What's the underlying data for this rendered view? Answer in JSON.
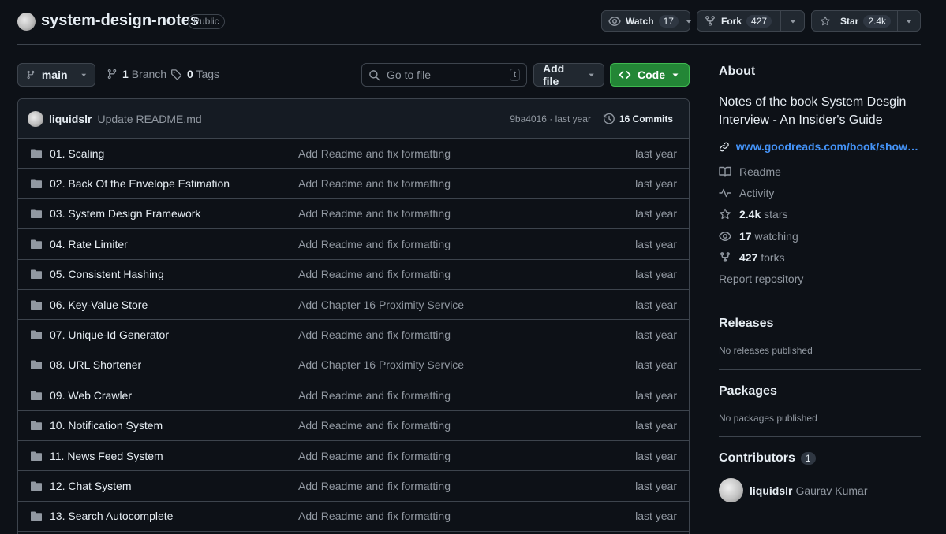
{
  "repo": {
    "name": "system-design-notes",
    "visibility": "Public"
  },
  "header_actions": {
    "watch": {
      "label": "Watch",
      "count": "17"
    },
    "fork": {
      "label": "Fork",
      "count": "427"
    },
    "star": {
      "label": "Star",
      "count": "2.4k"
    }
  },
  "toolbar": {
    "branch": "main",
    "branch_count": "1",
    "branch_label": "Branch",
    "tag_count": "0",
    "tag_label": "Tags",
    "search_placeholder": "Go to file",
    "search_shortcut": "t",
    "add_file": "Add file",
    "code": "Code"
  },
  "latest_commit": {
    "user": "liquidslr",
    "message": "Update README.md",
    "hash_time": "9ba4016 · last year",
    "commits": "16 Commits"
  },
  "files": [
    {
      "name": "01. Scaling",
      "message": "Add Readme and fix formatting",
      "date": "last year"
    },
    {
      "name": "02. Back Of the Envelope Estimation",
      "message": "Add Readme and fix formatting",
      "date": "last year"
    },
    {
      "name": "03. System Design Framework",
      "message": "Add Readme and fix formatting",
      "date": "last year"
    },
    {
      "name": "04. Rate Limiter",
      "message": "Add Readme and fix formatting",
      "date": "last year"
    },
    {
      "name": "05. Consistent Hashing",
      "message": "Add Readme and fix formatting",
      "date": "last year"
    },
    {
      "name": "06. Key-Value Store",
      "message": "Add Chapter 16 Proximity Service",
      "date": "last year"
    },
    {
      "name": "07. Unique-Id Generator",
      "message": "Add Readme and fix formatting",
      "date": "last year"
    },
    {
      "name": "08. URL Shortener",
      "message": "Add Chapter 16 Proximity Service",
      "date": "last year"
    },
    {
      "name": "09. Web Crawler",
      "message": "Add Readme and fix formatting",
      "date": "last year"
    },
    {
      "name": "10. Notification System",
      "message": "Add Readme and fix formatting",
      "date": "last year"
    },
    {
      "name": "11. News Feed System",
      "message": "Add Readme and fix formatting",
      "date": "last year"
    },
    {
      "name": "12. Chat System",
      "message": "Add Readme and fix formatting",
      "date": "last year"
    },
    {
      "name": "13. Search Autocomplete",
      "message": "Add Readme and fix formatting",
      "date": "last year"
    }
  ],
  "about": {
    "title": "About",
    "description": "Notes of the book System Desgin Interview - An Insider's Guide",
    "link": "www.goodreads.com/book/show/541...",
    "readme": "Readme",
    "activity": "Activity",
    "stars_count": "2.4k",
    "stars_label": "stars",
    "watching_count": "17",
    "watching_label": "watching",
    "forks_count": "427",
    "forks_label": "forks",
    "report": "Report repository"
  },
  "releases": {
    "title": "Releases",
    "note": "No releases published"
  },
  "packages": {
    "title": "Packages",
    "note": "No packages published"
  },
  "contributors": {
    "title": "Contributors",
    "count": "1",
    "items": [
      {
        "login": "liquidslr",
        "name": "Gaurav Kumar"
      }
    ]
  },
  "colors": {
    "background": "#0d1117",
    "border": "#3d444d",
    "link": "#4493f8",
    "primary_button": "#238636",
    "muted_text": "#9198a1"
  },
  "icons": [
    "eye-icon",
    "fork-icon",
    "star-icon",
    "branch-icon",
    "tag-icon",
    "search-icon",
    "history-icon",
    "folder-icon",
    "link-icon",
    "book-icon",
    "pulse-icon"
  ]
}
